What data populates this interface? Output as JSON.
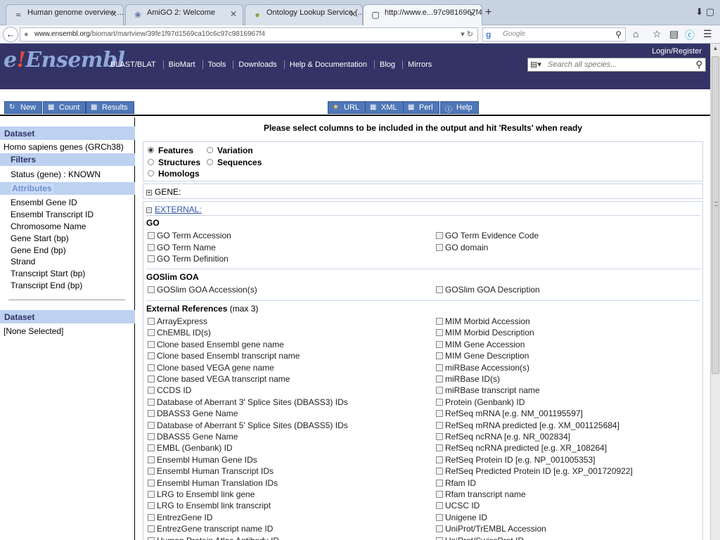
{
  "browser": {
    "tabs": [
      {
        "label": "Human genome overview ...",
        "icon": "ensembl-favicon"
      },
      {
        "label": "AmiGO 2: Welcome",
        "icon": "amigo-favicon"
      },
      {
        "label": "Ontology Lookup Service (...",
        "icon": "ols-favicon"
      },
      {
        "label": "http://www.e...97c9816967f4",
        "icon": "page-favicon"
      }
    ],
    "url_host": "www.ensembl.org",
    "url_path": "/biomart/martview/39fe1f97d1569ca10c6c97c9816967f4",
    "search_placeholder": "Google"
  },
  "header": {
    "logo_e": "e",
    "logo_bang": "!",
    "logo_rest": "Ensembl",
    "nav": [
      "BLAST/BLAT",
      "BioMart",
      "Tools",
      "Downloads",
      "Help & Documentation",
      "Blog",
      "Mirrors"
    ],
    "login": "Login/Register",
    "search_placeholder": "Search all species..."
  },
  "toolbar": {
    "new": "New",
    "count": "Count",
    "results": "Results",
    "url": "URL",
    "xml": "XML",
    "perl": "Perl",
    "help": "Help"
  },
  "left": {
    "dataset_head": "Dataset",
    "dataset_value": "Homo sapiens genes (GRCh38)",
    "filters_head": "Filters",
    "filters_value": "Status (gene) : KNOWN",
    "attributes_head": "Attributes",
    "attributes": [
      "Ensembl Gene ID",
      "Ensembl Transcript ID",
      "Chromosome Name",
      "Gene Start (bp)",
      "Gene End (bp)",
      "Strand",
      "Transcript Start (bp)",
      "Transcript End (bp)"
    ],
    "dataset2_head": "Dataset",
    "dataset2_value": "[None Selected]"
  },
  "main": {
    "instructions": "Please select columns to be included in the output and hit 'Results' when ready",
    "radios": {
      "features": "Features",
      "variation": "Variation",
      "structures": "Structures",
      "sequences": "Sequences",
      "homologs": "Homologs",
      "selected": "Features"
    },
    "gene_label": "GENE:",
    "external_label": "EXTERNAL:",
    "go_title": "GO",
    "go_left": [
      "GO Term Accession",
      "GO Term Name",
      "GO Term Definition"
    ],
    "go_right": [
      "GO Term Evidence Code",
      "GO domain"
    ],
    "goslim_title": "GOSlim GOA",
    "goslim_left": [
      "GOSlim GOA Accession(s)"
    ],
    "goslim_right": [
      "GOSlim GOA Description"
    ],
    "xref_title": "External References",
    "xref_max": "(max 3)",
    "xref_left": [
      "ArrayExpress",
      "ChEMBL ID(s)",
      "Clone based Ensembl gene name",
      "Clone based Ensembl transcript name",
      "Clone based VEGA gene name",
      "Clone based VEGA transcript name",
      "CCDS ID",
      "Database of Aberrant 3' Splice Sites (DBASS3) IDs",
      "DBASS3 Gene Name",
      "Database of Aberrant 5' Splice Sites (DBASS5) IDs",
      "DBASS5 Gene Name",
      "EMBL (Genbank) ID",
      "Ensembl Human Gene IDs",
      "Ensembl Human Transcript IDs",
      "Ensembl Human Translation IDs",
      "LRG to Ensembl link gene",
      "LRG to Ensembl link transcript",
      "EntrezGene ID",
      "EntrezGene transcript name ID",
      "Human Protein Atlas Antibody ID"
    ],
    "xref_right": [
      "MIM Morbid Accession",
      "MIM Morbid Description",
      "MIM Gene Accession",
      "MIM Gene Description",
      "miRBase Accession(s)",
      "miRBase ID(s)",
      "miRBase transcript name",
      "Protein (Genbank) ID",
      "RefSeq mRNA [e.g. NM_001195597]",
      "RefSeq mRNA predicted [e.g. XM_001125684]",
      "RefSeq ncRNA [e.g. NR_002834]",
      "RefSeq ncRNA predicted [e.g. XR_108264]",
      "RefSeq Protein ID [e.g. NP_001005353]",
      "RefSeq Predicted Protein ID [e.g. XP_001720922]",
      "Rfam ID",
      "Rfam transcript name",
      "UCSC ID",
      "Unigene ID",
      "UniProt/TrEMBL Accession",
      "UniProt/SwissProt ID"
    ]
  },
  "colors": {
    "header_bg": "#333366",
    "panel_head": "#bdd1f0",
    "button": "#4f77b7"
  }
}
